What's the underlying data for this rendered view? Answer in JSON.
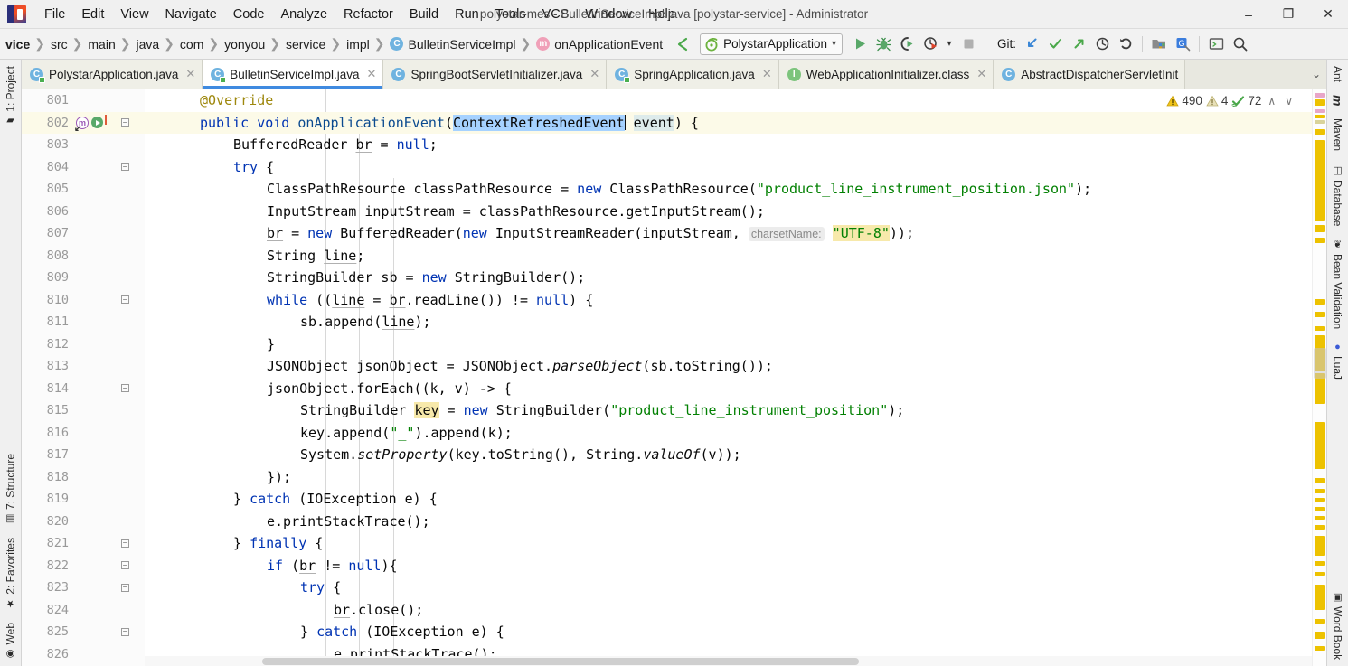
{
  "titlebar": {
    "window_title": "polystar-mes - BulletinServiceImpl.java [polystar-service] - Administrator",
    "logo_name": "intellij-idea-logo",
    "menu": [
      {
        "label": "File"
      },
      {
        "label": "Edit"
      },
      {
        "label": "View"
      },
      {
        "label": "Navigate"
      },
      {
        "label": "Code"
      },
      {
        "label": "Analyze"
      },
      {
        "label": "Refactor"
      },
      {
        "label": "Build"
      },
      {
        "label": "Run"
      },
      {
        "label": "Tools"
      },
      {
        "label": "VCS"
      },
      {
        "label": "Window"
      },
      {
        "label": "Help"
      }
    ],
    "minimize": "–",
    "maximize": "❐",
    "close": "✕"
  },
  "navbar": {
    "breadcrumbs": [
      {
        "label": "vice",
        "icon": ""
      },
      {
        "label": "src",
        "icon": ""
      },
      {
        "label": "main",
        "icon": ""
      },
      {
        "label": "java",
        "icon": ""
      },
      {
        "label": "com",
        "icon": ""
      },
      {
        "label": "yonyou",
        "icon": ""
      },
      {
        "label": "service",
        "icon": ""
      },
      {
        "label": "impl",
        "icon": ""
      },
      {
        "label": "BulletinServiceImpl",
        "icon": "C"
      },
      {
        "label": "onApplicationEvent",
        "icon": "m"
      }
    ],
    "back_arrow": "↖",
    "run_config": "PolystarApplication",
    "run_config_caret": "▾",
    "git_label": "Git:"
  },
  "tabs": [
    {
      "label": "PolystarApplication.java",
      "icon": "java",
      "active": false,
      "close": "✕"
    },
    {
      "label": "BulletinServiceImpl.java",
      "icon": "java",
      "active": true,
      "close": "✕"
    },
    {
      "label": "SpringBootServletInitializer.java",
      "icon": "java",
      "active": false,
      "close": "✕"
    },
    {
      "label": "SpringApplication.java",
      "icon": "java",
      "active": false,
      "close": "✕"
    },
    {
      "label": "WebApplicationInitializer.class",
      "icon": "iface",
      "active": false,
      "close": "✕"
    },
    {
      "label": "AbstractDispatcherServletInit",
      "icon": "java",
      "active": false,
      "close": ""
    }
  ],
  "tabs_overflow": "⌄",
  "inspections": {
    "warning_icon": "⚠",
    "warning_count": "490",
    "weak_warning_icon": "⚠",
    "weak_warning_count": "4",
    "check_icon": "✔",
    "check_count": "72",
    "up": "∧",
    "down": "∨"
  },
  "sidebar_left": [
    {
      "label": "1: Project",
      "icon": "project-icon"
    },
    {
      "label": "7: Structure",
      "icon": "structure-icon"
    },
    {
      "label": "2: Favorites",
      "icon": "star-icon"
    },
    {
      "label": "Web",
      "icon": "web-icon"
    }
  ],
  "sidebar_right": [
    {
      "label": "Ant",
      "icon": "ant-icon"
    },
    {
      "label": "m",
      "icon": "maven-m-icon"
    },
    {
      "label": "Maven",
      "icon": "maven-icon"
    },
    {
      "label": "Database",
      "icon": "database-icon"
    },
    {
      "label": "Bean Validation",
      "icon": "bean-icon"
    },
    {
      "label": "LuaJ",
      "icon": "luaj-icon"
    },
    {
      "label": "Word Book",
      "icon": "wordbook-icon"
    }
  ],
  "editor": {
    "first_visible_line": 801,
    "current_line": 802,
    "selection_text": "ContextRefreshedEvent",
    "lines": [
      {
        "n": "801",
        "current": false,
        "fold": false
      },
      {
        "n": "802",
        "current": true,
        "fold": true
      },
      {
        "n": "803",
        "current": false,
        "fold": false
      },
      {
        "n": "804",
        "current": false,
        "fold": true
      },
      {
        "n": "805",
        "current": false,
        "fold": false
      },
      {
        "n": "806",
        "current": false,
        "fold": false
      },
      {
        "n": "807",
        "current": false,
        "fold": false
      },
      {
        "n": "808",
        "current": false,
        "fold": false
      },
      {
        "n": "809",
        "current": false,
        "fold": false
      },
      {
        "n": "810",
        "current": false,
        "fold": true
      },
      {
        "n": "811",
        "current": false,
        "fold": false
      },
      {
        "n": "812",
        "current": false,
        "fold": false
      },
      {
        "n": "813",
        "current": false,
        "fold": false
      },
      {
        "n": "814",
        "current": false,
        "fold": true
      },
      {
        "n": "815",
        "current": false,
        "fold": false
      },
      {
        "n": "816",
        "current": false,
        "fold": false
      },
      {
        "n": "817",
        "current": false,
        "fold": false
      },
      {
        "n": "818",
        "current": false,
        "fold": false
      },
      {
        "n": "819",
        "current": false,
        "fold": false
      },
      {
        "n": "820",
        "current": false,
        "fold": false
      },
      {
        "n": "821",
        "current": false,
        "fold": true
      },
      {
        "n": "822",
        "current": false,
        "fold": true
      },
      {
        "n": "823",
        "current": false,
        "fold": true
      },
      {
        "n": "824",
        "current": false,
        "fold": false
      },
      {
        "n": "825",
        "current": false,
        "fold": true
      },
      {
        "n": "826",
        "current": false,
        "fold": false
      }
    ],
    "code_text": [
      "        @Override",
      "        public void onApplicationEvent(ContextRefreshedEvent event) {",
      "            BufferedReader br = null;",
      "            try {",
      "                ClassPathResource classPathResource = new ClassPathResource(\"product_line_instrument_position.json\");",
      "                InputStream inputStream = classPathResource.getInputStream();",
      "                br = new BufferedReader(new InputStreamReader(inputStream, charsetName: \"UTF-8\"));",
      "                String line;",
      "                StringBuilder sb = new StringBuilder();",
      "                while ((line = br.readLine()) != null) {",
      "                    sb.append(line);",
      "                }",
      "                JSONObject jsonObject = JSONObject.parseObject(sb.toString());",
      "                jsonObject.forEach((k, v) -> {",
      "                    StringBuilder key = new StringBuilder(\"product_line_instrument_position\");",
      "                    key.append(\"_\").append(k);",
      "                    System.setProperty(key.toString(), String.valueOf(v));",
      "                });",
      "            } catch (IOException e) {",
      "                e.printStackTrace();",
      "            } finally {",
      "                if (br != null){",
      "                    try {",
      "                        br.close();",
      "                    } catch (IOException e) {",
      "                        e.printStackTrace();"
    ]
  },
  "colors": {
    "keyword": "#0033b3",
    "string": "#028002",
    "annotation": "#9e880d",
    "selection": "#a6d2ff",
    "current_line": "#fcfae8",
    "highlight": "#f7e9ab",
    "warning_marker": "#edc200",
    "accent": "#3f8ae0"
  }
}
